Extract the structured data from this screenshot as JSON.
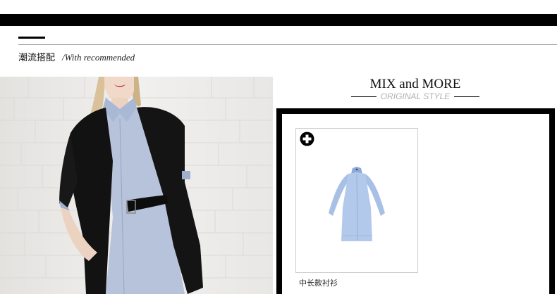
{
  "section": {
    "title": "潮流搭配",
    "subtitle": "/With recommended"
  },
  "mix": {
    "title": "MIX and MORE",
    "subtitle": "ORIGINAL STYLE"
  },
  "product": {
    "name": "中长款衬衫",
    "add_icon": "plus-circle-icon"
  },
  "colors": {
    "accent": "#000000",
    "rule": "#9a9a9a",
    "subtitle_gray": "#b0b0b0",
    "shirt_blue": "#a9c0e6",
    "card_border": "#cfcfcf"
  }
}
